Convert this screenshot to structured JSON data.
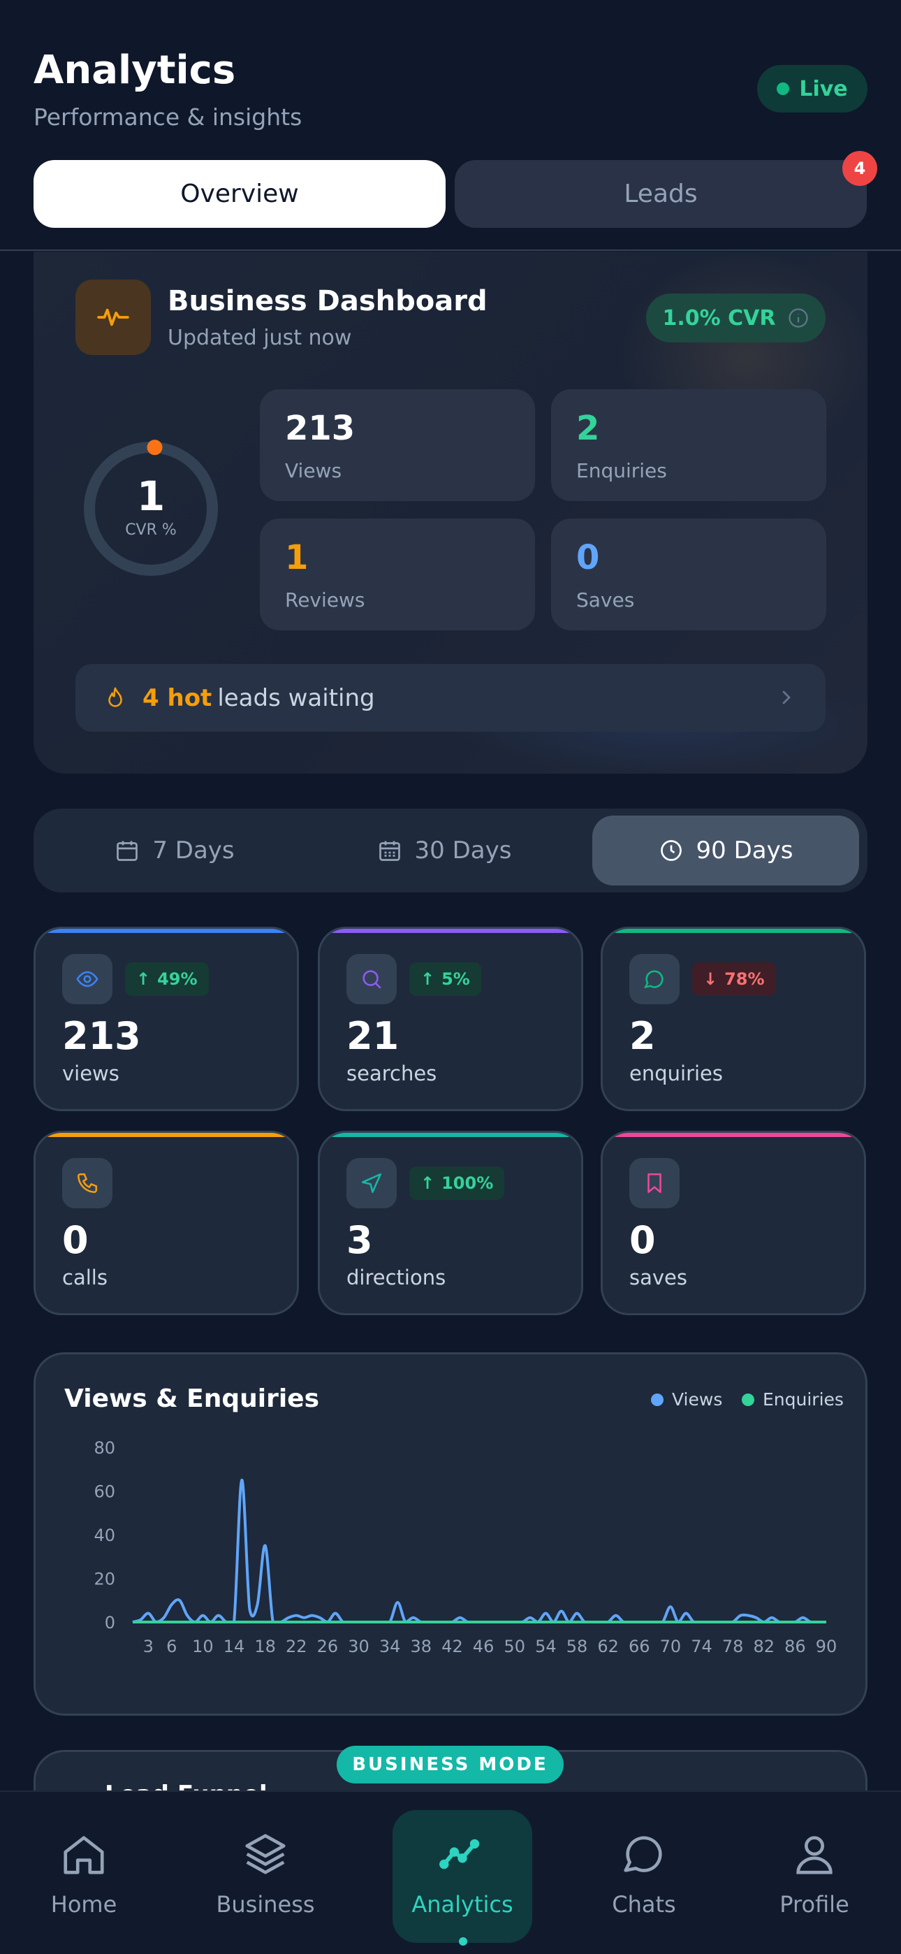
{
  "header": {
    "title": "Analytics",
    "subtitle": "Performance & insights",
    "live_label": "Live"
  },
  "tabs": [
    {
      "label": "Overview",
      "active": true
    },
    {
      "label": "Leads",
      "badge": "4"
    }
  ],
  "dashboard": {
    "title": "Business Dashboard",
    "updated": "Updated just now",
    "cvr_pill": "1.0% CVR",
    "ring_value": "1",
    "ring_label": "CVR %",
    "ring_fraction": 0.01,
    "stats": [
      {
        "value": "213",
        "label": "Views",
        "color": "#ffffff"
      },
      {
        "value": "2",
        "label": "Enquiries",
        "color": "#34d399"
      },
      {
        "value": "1",
        "label": "Reviews",
        "color": "#f59e0b"
      },
      {
        "value": "0",
        "label": "Saves",
        "color": "#60a5fa"
      }
    ],
    "hot_count": "4 hot",
    "hot_text": "leads waiting"
  },
  "ranges": [
    {
      "label": "7 Days",
      "icon": "calendar-icon"
    },
    {
      "label": "30 Days",
      "icon": "calendar-grid-icon"
    },
    {
      "label": "90 Days",
      "icon": "clock-icon",
      "active": true
    }
  ],
  "metrics": [
    {
      "value": "213",
      "label": "views",
      "change": "49%",
      "dir": "up",
      "accent": "#3b82f6",
      "icon": "eye-icon"
    },
    {
      "value": "21",
      "label": "searches",
      "change": "5%",
      "dir": "up",
      "accent": "#8b5cf6",
      "icon": "search-icon"
    },
    {
      "value": "2",
      "label": "enquiries",
      "change": "78%",
      "dir": "down",
      "accent": "#10b981",
      "icon": "chat-bubble-icon"
    },
    {
      "value": "0",
      "label": "calls",
      "change": "",
      "dir": "",
      "accent": "#f59e0b",
      "icon": "phone-icon"
    },
    {
      "value": "3",
      "label": "directions",
      "change": "100%",
      "dir": "up",
      "accent": "#14b8a6",
      "icon": "navigation-icon"
    },
    {
      "value": "0",
      "label": "saves",
      "change": "",
      "dir": "",
      "accent": "#ec4899",
      "icon": "bookmark-icon"
    }
  ],
  "chart_data": {
    "type": "line",
    "title": "Views & Enquiries",
    "xlabel": "",
    "ylabel": "",
    "ylim": [
      0,
      80
    ],
    "yticks": [
      0,
      20,
      40,
      60,
      80
    ],
    "xticks": [
      3,
      6,
      10,
      14,
      18,
      22,
      26,
      30,
      34,
      38,
      42,
      46,
      50,
      54,
      58,
      62,
      66,
      70,
      74,
      78,
      82,
      86,
      90
    ],
    "xlim": [
      1,
      90
    ],
    "grid": false,
    "legend": "top-right",
    "series": [
      {
        "name": "Views",
        "color": "#60a5fa",
        "x": [
          1,
          2,
          3,
          4,
          5,
          6,
          7,
          8,
          9,
          10,
          11,
          12,
          13,
          14,
          15,
          16,
          17,
          18,
          19,
          20,
          21,
          22,
          23,
          24,
          25,
          26,
          27,
          28,
          29,
          30,
          31,
          32,
          33,
          34,
          35,
          36,
          37,
          38,
          39,
          40,
          41,
          42,
          43,
          44,
          45,
          46,
          47,
          48,
          49,
          50,
          51,
          52,
          53,
          54,
          55,
          56,
          57,
          58,
          59,
          60,
          61,
          62,
          63,
          64,
          65,
          66,
          67,
          68,
          69,
          70,
          71,
          72,
          73,
          74,
          75,
          76,
          77,
          78,
          79,
          80,
          81,
          82,
          83,
          84,
          85,
          86,
          87,
          88,
          89,
          90
        ],
        "values": [
          0,
          1,
          4,
          0,
          2,
          8,
          10,
          3,
          0,
          3,
          0,
          3,
          0,
          0,
          65,
          6,
          8,
          35,
          0,
          0,
          2,
          3,
          2,
          3,
          2,
          0,
          4,
          0,
          0,
          0,
          0,
          0,
          0,
          0,
          9,
          0,
          2,
          0,
          0,
          0,
          0,
          0,
          2,
          0,
          0,
          0,
          0,
          0,
          0,
          0,
          0,
          2,
          0,
          4,
          0,
          5,
          0,
          4,
          0,
          0,
          0,
          0,
          3,
          0,
          0,
          0,
          0,
          0,
          0,
          7,
          0,
          4,
          0,
          0,
          0,
          0,
          0,
          0,
          3,
          3,
          2,
          0,
          2,
          0,
          0,
          0,
          2,
          0,
          0,
          0
        ]
      },
      {
        "name": "Enquiries",
        "color": "#34d399",
        "x": [
          1,
          90
        ],
        "values": [
          0,
          0
        ]
      }
    ]
  },
  "lower_card": {
    "title": "Lead Funnel"
  },
  "business_mode": "BUSINESS MODE",
  "nav": [
    {
      "label": "Home",
      "icon": "home-icon"
    },
    {
      "label": "Business",
      "icon": "layers-icon"
    },
    {
      "label": "Analytics",
      "icon": "trend-line-icon",
      "active": true
    },
    {
      "label": "Chats",
      "icon": "chat-icon"
    },
    {
      "label": "Profile",
      "icon": "user-icon"
    }
  ]
}
